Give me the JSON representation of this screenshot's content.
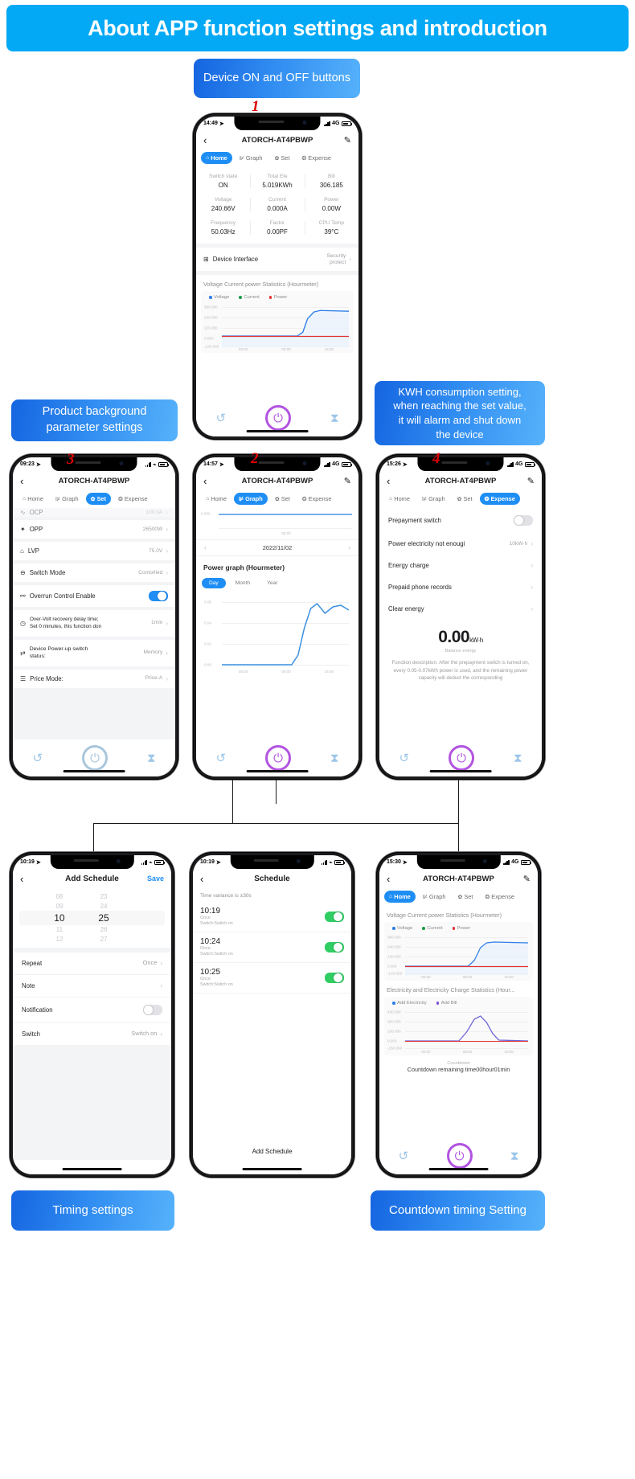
{
  "header": {
    "title": "About APP function settings and introduction",
    "bg": "#03a9f4"
  },
  "callouts": {
    "device_on_off": "Device ON and OFF buttons",
    "background_params": "Product background\nparameter settings",
    "kwh_consumption": "KWH consumption setting,\nwhen reaching the set value,\nit will alarm and shut down\nthe device",
    "timing_settings": "Timing settings",
    "countdown_timing": "Countdown timing Setting"
  },
  "markers": {
    "one": "1",
    "two": "2",
    "three": "3",
    "four": "4"
  },
  "common": {
    "device_title": "ATORCH-AT4PBWP",
    "back_icon": "chevron-left-icon",
    "edit_icon": "pencil-icon",
    "tabs": [
      {
        "label": "Home",
        "icon": "home-icon"
      },
      {
        "label": "Graph",
        "icon": "chart-icon"
      },
      {
        "label": "Set",
        "icon": "gear-icon"
      },
      {
        "label": "Expense",
        "icon": "expense-icon"
      }
    ]
  },
  "phone1": {
    "status": {
      "time": "14:49",
      "network": "4G"
    },
    "active_tab": "Home",
    "metrics": [
      {
        "label": "Switch state",
        "value": "ON"
      },
      {
        "label": "Total Ele",
        "value": "5.019KWh"
      },
      {
        "label": "Bill",
        "value": "306.185"
      },
      {
        "label": "Voltage",
        "value": "240.66V"
      },
      {
        "label": "Current",
        "value": "0.000A"
      },
      {
        "label": "Power",
        "value": "0.00W"
      },
      {
        "label": "Frequency",
        "value": "50.03Hz"
      },
      {
        "label": "Factor",
        "value": "0.00PF"
      },
      {
        "label": "CPU Temp",
        "value": "39°C"
      }
    ],
    "device_interface": {
      "label": "Device Interface",
      "value": "Security\nprotect"
    },
    "chart_title": "Voltage Current power Statistics (Hourmeter)",
    "legend": [
      {
        "label": "Voltage",
        "color": "#2f7fe8"
      },
      {
        "label": "Current",
        "color": "#1e9e4a"
      },
      {
        "label": "Power",
        "color": "#e03131"
      }
    ],
    "yticks": [
      "360.000",
      "240.000",
      "120.000",
      "0.000",
      "-120.000"
    ],
    "xticks": [
      "00:00",
      "08:00",
      "16:00"
    ]
  },
  "phone2": {
    "status": {
      "time": "14:57",
      "network": "4G"
    },
    "active_tab": "Graph",
    "date": "2022/11/02",
    "graph_title": "Power graph (Hourmeter)",
    "range_tabs": [
      "Day",
      "Month",
      "Year"
    ],
    "active_range": "Day",
    "yticks": [
      "0.06",
      "0.04",
      "0.02",
      "0.00"
    ],
    "xticks": [
      "00:00",
      "08:00",
      "16:00"
    ],
    "top_yticks": [
      "0.000"
    ]
  },
  "phone3": {
    "status": {
      "time": "09:23",
      "network": "wifi"
    },
    "active_tab": "Set",
    "rows": [
      {
        "icon": "wave-icon",
        "label": "OCP",
        "value": "100.0A"
      },
      {
        "icon": "power-icon",
        "label": "OPP",
        "value": "26500W"
      },
      {
        "icon": "low-volt-icon",
        "label": "LVP",
        "value": "75.0V"
      },
      {
        "icon": "minus-circle-icon",
        "label": "Switch Mode",
        "value": "Contorlled"
      },
      {
        "icon": "link-icon",
        "label": "Overrun Control Enable",
        "value": "",
        "toggle": true
      },
      {
        "icon": "clock-icon",
        "label": "Over-Volt recovery delay time;\nSet 0 minutes, this function don",
        "value": "1min"
      },
      {
        "icon": "sliders-icon",
        "label": "Device Power-up switch\nstatus:",
        "value": "Memory"
      },
      {
        "icon": "list-icon",
        "label": "Price Mode:",
        "value": "Price-A"
      }
    ]
  },
  "phone4": {
    "status": {
      "time": "15:26",
      "network": "4G"
    },
    "active_tab": "Expense",
    "rows": [
      {
        "label": "Prepayment switch",
        "toggle": true
      },
      {
        "label": "Power electricity not enougi",
        "value": "10kW·h"
      },
      {
        "label": "Energy charge",
        "value": ""
      },
      {
        "label": "Prepaid phone records",
        "value": ""
      },
      {
        "label": "Clear energy",
        "value": ""
      }
    ],
    "balance_value": "0.00",
    "balance_unit": "kW·h",
    "balance_label": "Balance energy",
    "description": "Function description: After the prepayment switch is turned on, every 0.05-0.07kWh power is used, and the remaining power capacity will deduct the corresponding"
  },
  "phone5": {
    "status": {
      "time": "10:19",
      "network": "wifi"
    },
    "nav_title": "Add Schedule",
    "save_label": "Save",
    "picker": {
      "hours": [
        "08",
        "09",
        "10",
        "11",
        "12"
      ],
      "minutes": [
        "23",
        "24",
        "25",
        "26",
        "27"
      ],
      "selected_hour": "10",
      "selected_minute": "25"
    },
    "rows": [
      {
        "label": "Repeat",
        "value": "Once"
      },
      {
        "label": "Note",
        "value": ""
      },
      {
        "label": "Notification",
        "toggle": true
      },
      {
        "label": "Switch",
        "value": "Switch on"
      }
    ]
  },
  "phone6": {
    "status": {
      "time": "10:19",
      "network": "wifi"
    },
    "nav_title": "Schedule",
    "variance_note": "Time variance is ±30s",
    "items": [
      {
        "time": "10:19",
        "sub": "Once\nSwitch:Switch on",
        "on": true
      },
      {
        "time": "10:24",
        "sub": "Once\nSwitch:Switch on",
        "on": true
      },
      {
        "time": "10:25",
        "sub": "Once\nSwitch:Switch on",
        "on": true
      }
    ],
    "add_label": "Add Schedule"
  },
  "phone7": {
    "status": {
      "time": "15:30",
      "network": "4G"
    },
    "active_tab": "Home",
    "chart1_title": "Voltage Current power Statistics (Hourmeter)",
    "chart1_legend": [
      {
        "label": "Voltage",
        "color": "#2f7fe8"
      },
      {
        "label": "Current",
        "color": "#1e9e4a"
      },
      {
        "label": "Power",
        "color": "#e03131"
      }
    ],
    "chart1_yticks": [
      "360.000",
      "240.000",
      "120.000",
      "0.000",
      "-120.000"
    ],
    "chart1_xticks": [
      "00:00",
      "08:00",
      "16:00"
    ],
    "chart2_title": "Electricity and Electricity Charge Statistics (Hour...",
    "chart2_legend": [
      {
        "label": "Add Electricity",
        "color": "#2f7fe8"
      },
      {
        "label": "Add Bill",
        "color": "#7b4fd0"
      }
    ],
    "chart2_yticks": [
      "450.000",
      "300.000",
      "150.000",
      "0.000",
      "-150.000"
    ],
    "chart2_xticks": [
      "00:00",
      "08:00",
      "16:00"
    ],
    "countdown_label": "Countdown",
    "countdown_text": "Countdown remaining time00hour01min"
  },
  "chart_data": {
    "type": "line",
    "title": "Voltage Current power Statistics (Hourmeter)",
    "series": [
      {
        "name": "Voltage",
        "color": "#2f7fe8"
      },
      {
        "name": "Current",
        "color": "#1e9e4a"
      },
      {
        "name": "Power",
        "color": "#e03131"
      }
    ],
    "ylim": [
      -120,
      360
    ],
    "xticks": [
      "00:00",
      "08:00",
      "16:00"
    ]
  }
}
